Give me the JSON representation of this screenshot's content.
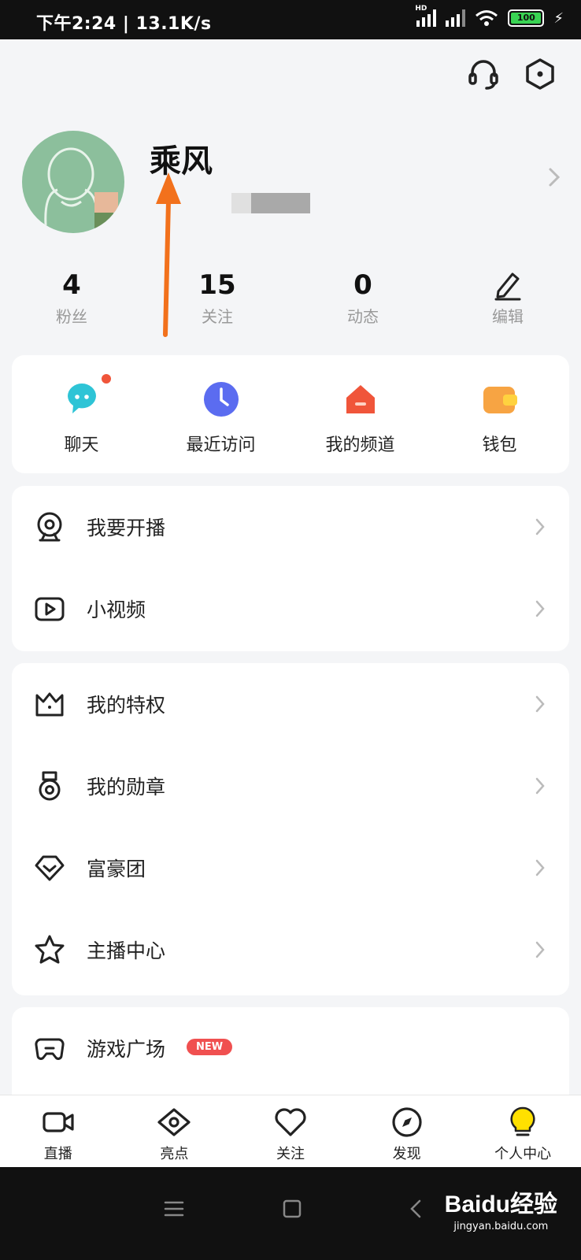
{
  "status_bar": {
    "time_speed": "下午2:24 | 13.1K/s",
    "network": "HD",
    "battery": "100"
  },
  "header": {
    "icons": [
      "headset-icon",
      "settings-hexagon-icon"
    ]
  },
  "profile": {
    "username": "乘风"
  },
  "stats": [
    {
      "value": "4",
      "label": "粉丝"
    },
    {
      "value": "15",
      "label": "关注"
    },
    {
      "value": "0",
      "label": "动态"
    },
    {
      "label": "编辑",
      "icon": "edit-pen-icon"
    }
  ],
  "quick_actions": [
    {
      "label": "聊天",
      "icon": "chat-bubble-icon",
      "color": "#2ec4d6"
    },
    {
      "label": "最近访问",
      "icon": "clock-icon",
      "color": "#5b6cf0"
    },
    {
      "label": "我的频道",
      "icon": "house-icon",
      "color": "#f0553a"
    },
    {
      "label": "钱包",
      "icon": "wallet-icon",
      "color": "#f7a443"
    }
  ],
  "menu_group_1": [
    {
      "label": "我要开播",
      "icon": "webcam-icon"
    },
    {
      "label": "小视频",
      "icon": "video-play-icon"
    }
  ],
  "menu_group_2": [
    {
      "label": "我的特权",
      "icon": "crown-icon"
    },
    {
      "label": "我的勋章",
      "icon": "medal-icon"
    },
    {
      "label": "富豪团",
      "icon": "diamond-icon"
    },
    {
      "label": "主播中心",
      "icon": "star-icon"
    }
  ],
  "menu_group_3": [
    {
      "label": "游戏广场",
      "icon": "gamepad-icon",
      "badge": "NEW"
    }
  ],
  "bottom_nav": [
    {
      "label": "直播",
      "icon": "video-camera-icon"
    },
    {
      "label": "亮点",
      "icon": "eye-icon"
    },
    {
      "label": "关注",
      "icon": "heart-icon"
    },
    {
      "label": "发现",
      "icon": "compass-icon"
    },
    {
      "label": "个人中心",
      "icon": "bulb-profile-icon",
      "active": true,
      "accent": "#ffe000"
    }
  ],
  "watermark": {
    "main": "Baidu经验",
    "sub": "jingyan.baidu.com"
  }
}
